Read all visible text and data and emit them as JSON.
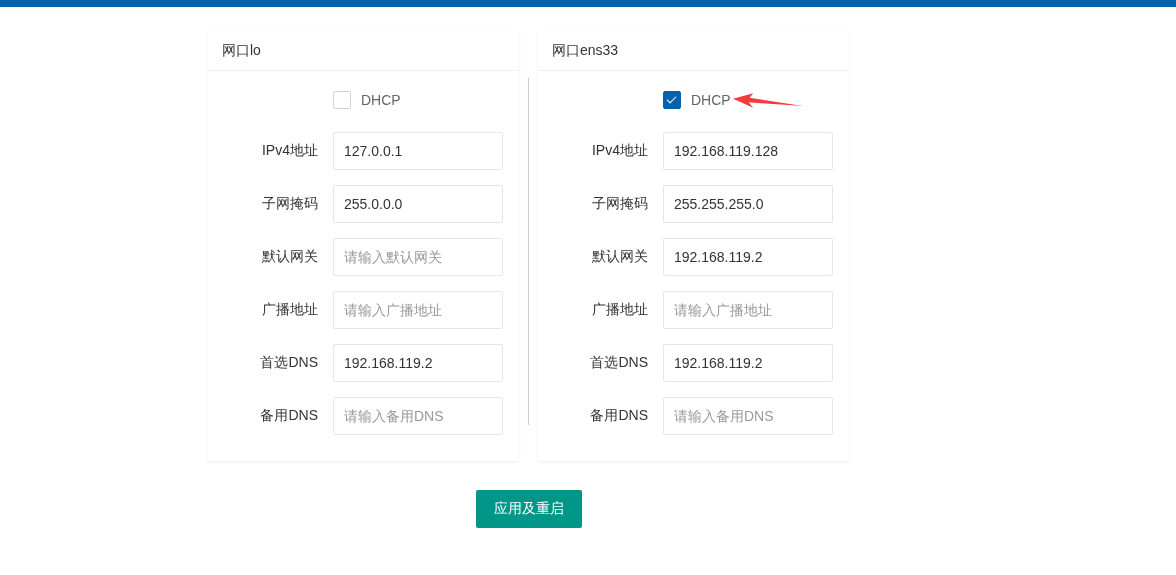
{
  "interfaces": [
    {
      "title": "网口lo",
      "dhcp": {
        "label": "DHCP",
        "checked": false
      },
      "fields": [
        {
          "label": "IPv4地址",
          "value": "127.0.0.1"
        },
        {
          "label": "子网掩码",
          "value": "255.0.0.0"
        },
        {
          "label": "默认网关",
          "placeholder": "请输入默认网关"
        },
        {
          "label": "广播地址",
          "placeholder": "请输入广播地址"
        },
        {
          "label": "首选DNS",
          "value": "192.168.119.2"
        },
        {
          "label": "备用DNS",
          "placeholder": "请输入备用DNS"
        }
      ]
    },
    {
      "title": "网口ens33",
      "dhcp": {
        "label": "DHCP",
        "checked": true
      },
      "fields": [
        {
          "label": "IPv4地址",
          "value": "192.168.119.128"
        },
        {
          "label": "子网掩码",
          "value": "255.255.255.0"
        },
        {
          "label": "默认网关",
          "value": "192.168.119.2"
        },
        {
          "label": "广播地址",
          "placeholder": "请输入广播地址"
        },
        {
          "label": "首选DNS",
          "value": "192.168.119.2"
        },
        {
          "label": "备用DNS",
          "placeholder": "请输入备用DNS"
        }
      ]
    }
  ],
  "submit_button": "应用及重启"
}
